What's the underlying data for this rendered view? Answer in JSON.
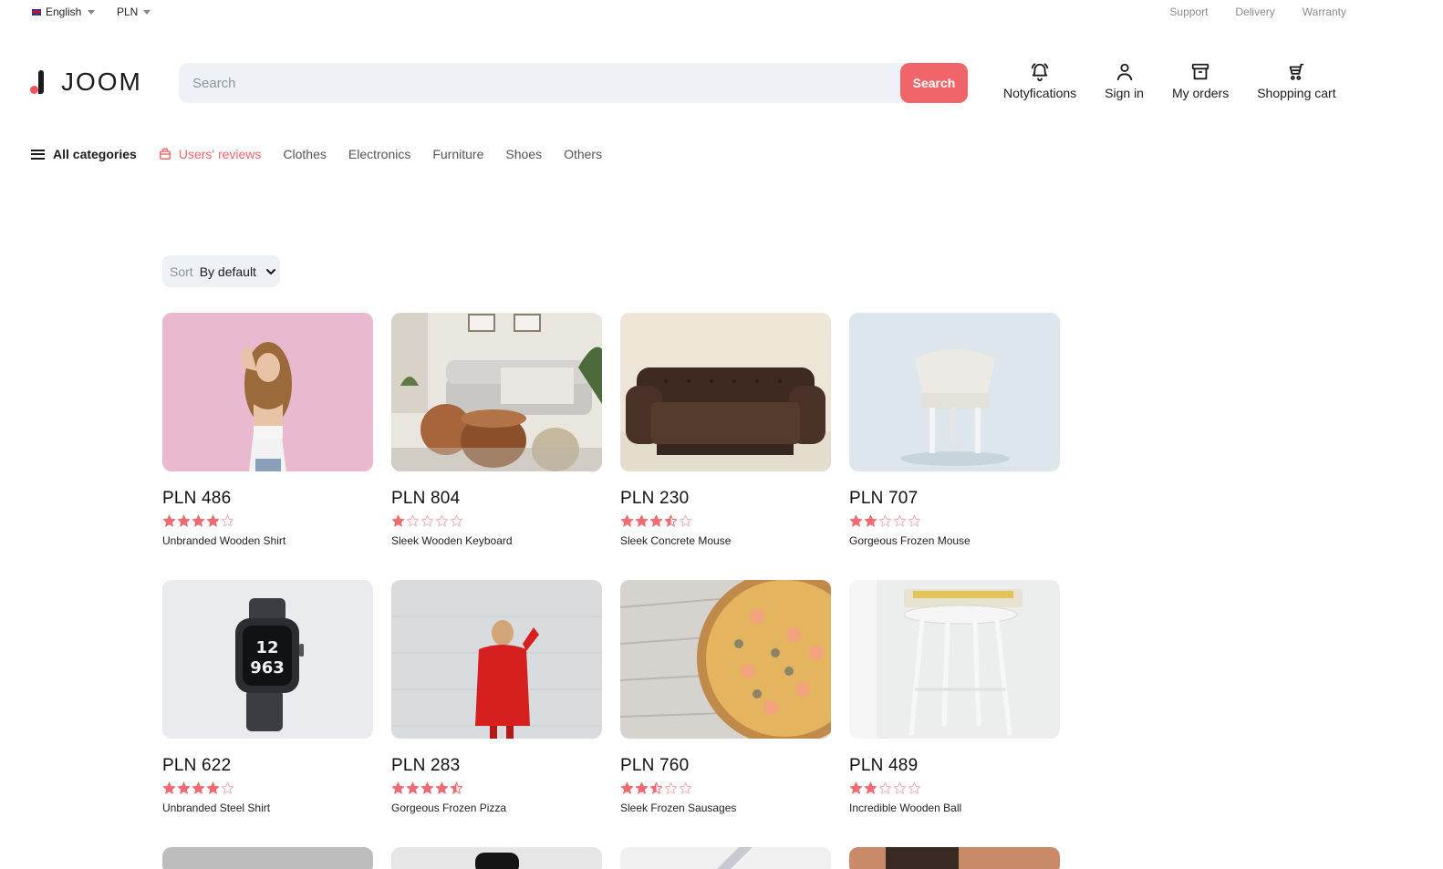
{
  "topbar": {
    "language": "English",
    "currency": "PLN",
    "links": [
      "Support",
      "Delivery",
      "Warranty"
    ]
  },
  "header": {
    "logo_text": "JOOM",
    "search_placeholder": "Search",
    "search_button": "Search",
    "actions": [
      {
        "label": "Notyfications",
        "icon": "bell-icon"
      },
      {
        "label": "Sign in",
        "icon": "user-icon"
      },
      {
        "label": "My orders",
        "icon": "box-icon"
      },
      {
        "label": "Shopping cart",
        "icon": "cart-icon"
      }
    ]
  },
  "nav": {
    "all_categories": "All categories",
    "reviews": "Users' reviews",
    "categories": [
      "Clothes",
      "Electronics",
      "Furniture",
      "Shoes",
      "Others"
    ]
  },
  "sort": {
    "label": "Sort",
    "value": "By default"
  },
  "colors": {
    "accent": "#f0656a",
    "star_filled": "#ef6b72",
    "star_empty": "#f2b3b6"
  },
  "products": [
    {
      "price": "PLN 486",
      "rating": 4,
      "name": "Unbranded Wooden Shirt",
      "image": "woman-pink-background"
    },
    {
      "price": "PLN 804",
      "rating": 1,
      "name": "Sleek Wooden Keyboard",
      "image": "living-room-sofa"
    },
    {
      "price": "PLN 230",
      "rating": 3.5,
      "name": "Sleek Concrete Mouse",
      "image": "leather-sofa"
    },
    {
      "price": "PLN 707",
      "rating": 2,
      "name": "Gorgeous Frozen Mouse",
      "image": "white-chair"
    },
    {
      "price": "PLN 622",
      "rating": 4,
      "name": "Unbranded Steel Shirt",
      "image": "smartwatch"
    },
    {
      "price": "PLN 283",
      "rating": 4.5,
      "name": "Gorgeous Frozen Pizza",
      "image": "woman-red-sweater"
    },
    {
      "price": "PLN 760",
      "rating": 2.5,
      "name": "Sleek Frozen Sausages",
      "image": "pizza"
    },
    {
      "price": "PLN 489",
      "rating": 2,
      "name": "Incredible Wooden Ball",
      "image": "white-stool"
    }
  ]
}
